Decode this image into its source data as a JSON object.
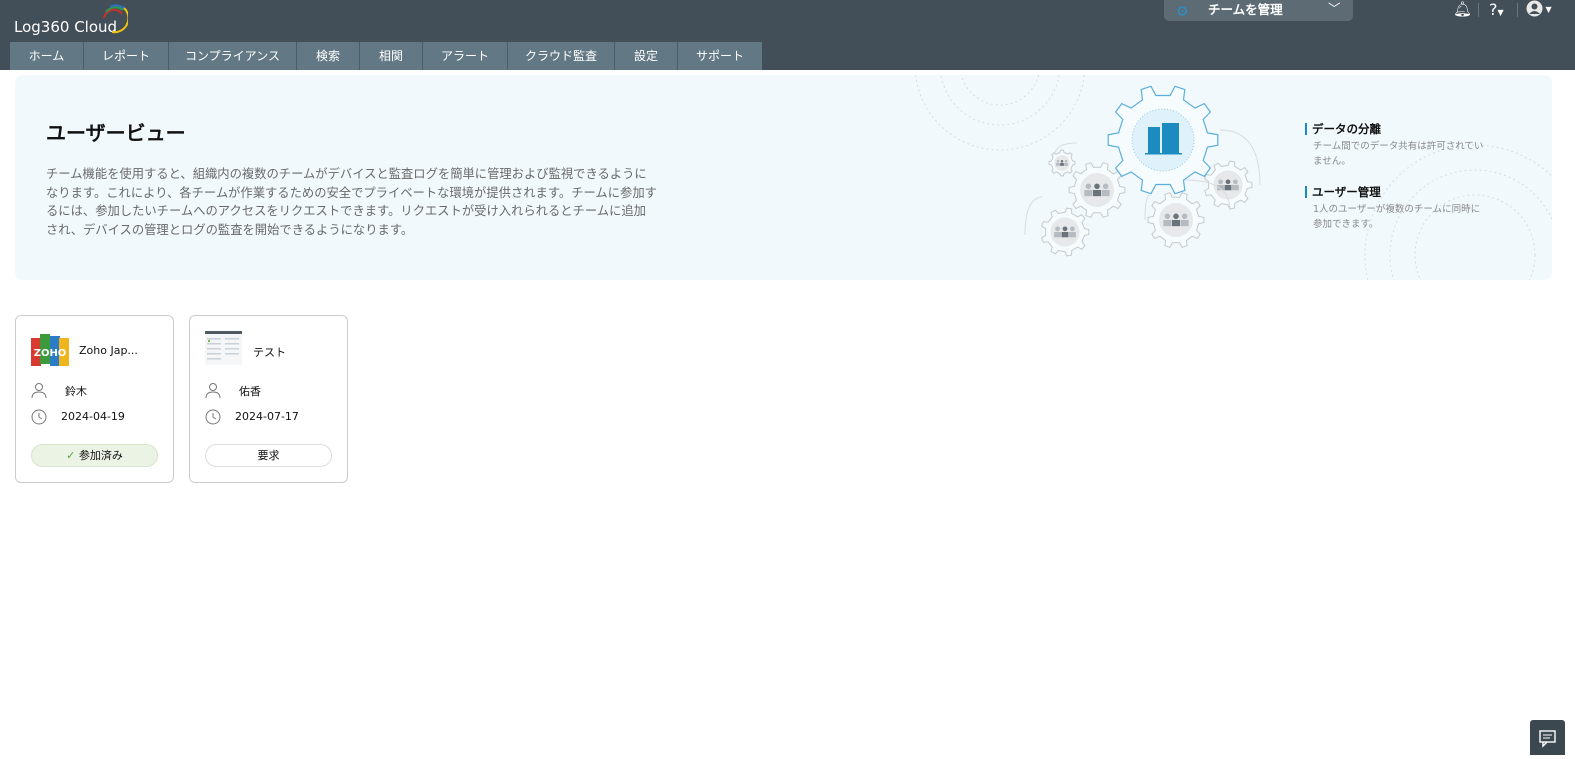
{
  "app": {
    "logo_text": "Log360 Cloud"
  },
  "nav": {
    "tabs": [
      "ホーム",
      "レポート",
      "コンプライアンス",
      "検索",
      "相関",
      "アラート",
      "クラウド監査",
      "設定",
      "サポート"
    ]
  },
  "header": {
    "team_label": "チームを管理",
    "help": "?"
  },
  "banner": {
    "title": "ユーザービュー",
    "description": "チーム機能を使用すると、組織内の複数のチームがデバイスと監査ログを簡単に管理および監視できるようになります。これにより、各チームが作業するための安全でプライベートな環境が提供されます。チームに参加するには、参加したいチームへのアクセスをリクエストできます。リクエストが受け入れられるとチームに追加され、デバイスの管理とログの監査を開始できるようになります。",
    "features": [
      {
        "title": "データの分離",
        "text": "チーム間でのデータ共有は許可されていません。"
      },
      {
        "title": "ユーザー管理",
        "text": "1人のユーザーが複数のチームに同時に参加できます。"
      }
    ]
  },
  "teams": [
    {
      "name": "Zoho Jap...",
      "logo_text": "ZOHO",
      "owner": "鈴木",
      "date": "2024-04-19",
      "action": "参加済み",
      "joined": true
    },
    {
      "name": "テスト",
      "owner": "佑香",
      "date": "2024-07-17",
      "action": "要求",
      "joined": false
    }
  ],
  "colors": {
    "topbar": "#434f58",
    "nav": "#627884",
    "accent": "#1b8bc0",
    "banner": "#f1f9fd"
  }
}
